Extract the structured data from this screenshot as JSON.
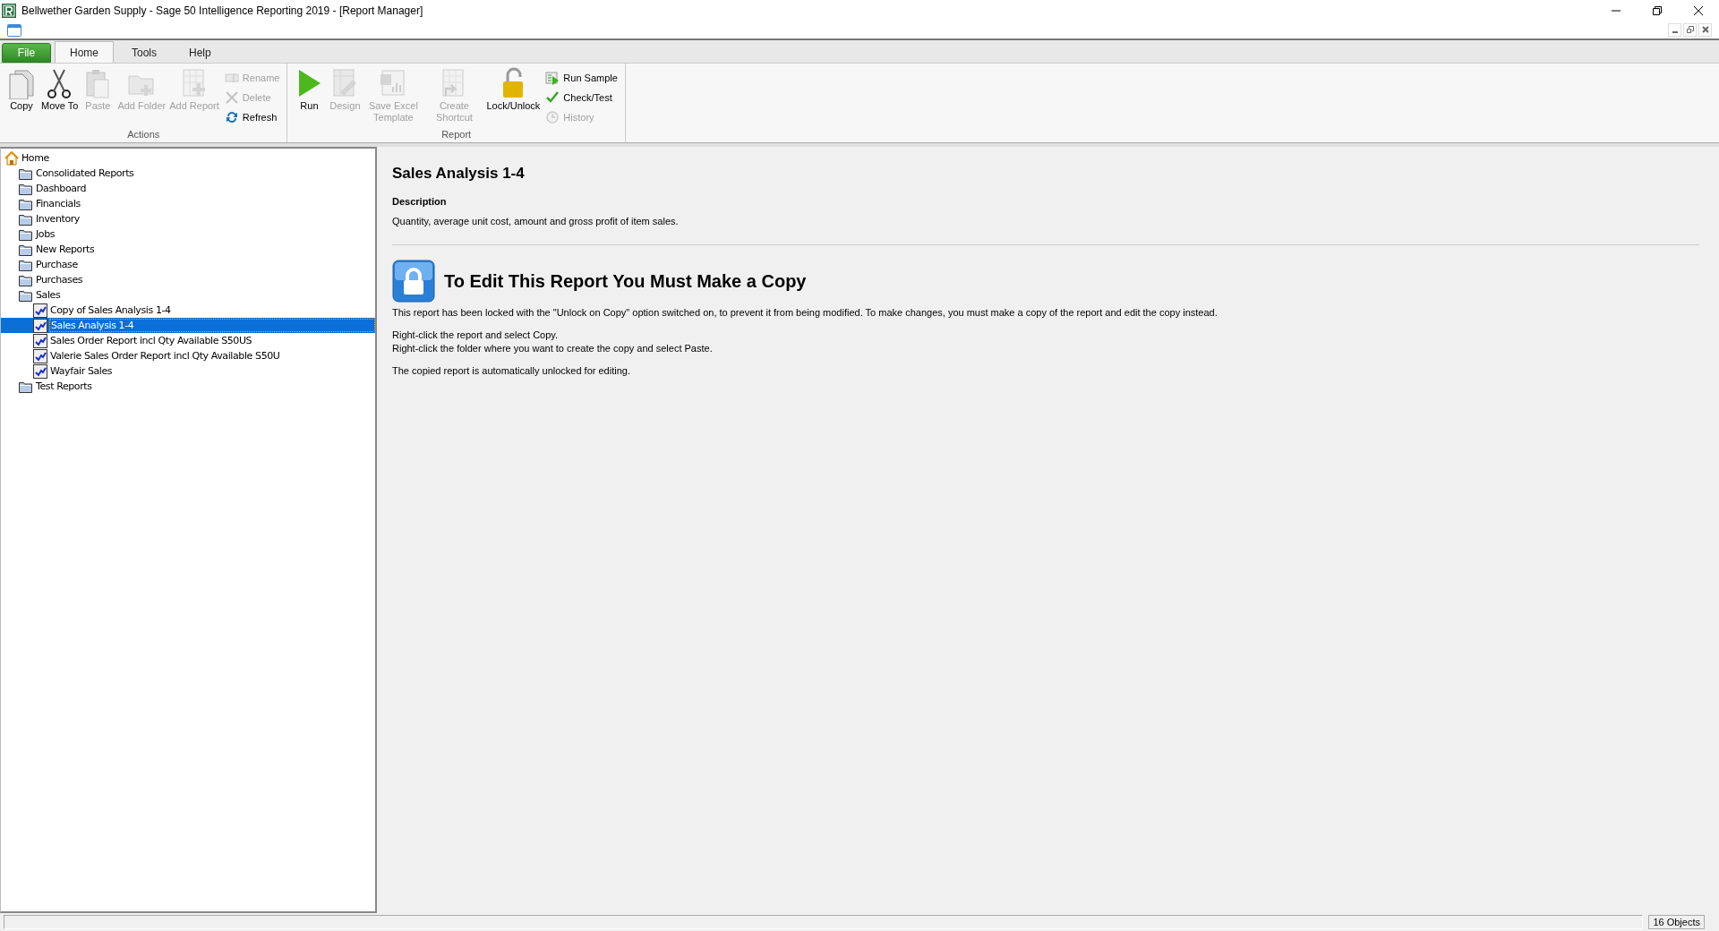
{
  "window": {
    "title": "Bellwether Garden Supply - Sage 50 Intelligence Reporting 2019 - [Report Manager]"
  },
  "ribbon": {
    "file_tab": "File",
    "tabs": [
      {
        "label": "Home",
        "selected": true
      },
      {
        "label": "Tools",
        "selected": false
      },
      {
        "label": "Help",
        "selected": false
      }
    ],
    "groups": [
      {
        "label": "Actions",
        "buttons": [
          {
            "kind": "large",
            "label": "Copy",
            "disabled": false
          },
          {
            "kind": "large",
            "label": "Move To",
            "disabled": false
          },
          {
            "kind": "large",
            "label": "Paste",
            "disabled": true
          },
          {
            "kind": "large",
            "label": "Add Folder",
            "disabled": true
          },
          {
            "kind": "large",
            "label": "Add Report",
            "disabled": true
          },
          {
            "kind": "small",
            "label": "Rename",
            "disabled": true
          },
          {
            "kind": "small",
            "label": "Delete",
            "disabled": true
          },
          {
            "kind": "small",
            "label": "Refresh",
            "disabled": false
          }
        ]
      },
      {
        "label": "Report",
        "buttons": [
          {
            "kind": "large",
            "label": "Run",
            "disabled": false
          },
          {
            "kind": "large",
            "label": "Design",
            "disabled": true
          },
          {
            "kind": "large",
            "label": "Save Excel Template",
            "disabled": true
          },
          {
            "kind": "large",
            "label": "Create Shortcut",
            "disabled": true
          },
          {
            "kind": "large",
            "label": "Lock/Unlock",
            "disabled": false
          },
          {
            "kind": "small",
            "label": "Run Sample",
            "disabled": false
          },
          {
            "kind": "small",
            "label": "Check/Test",
            "disabled": false
          },
          {
            "kind": "small",
            "label": "History",
            "disabled": true
          }
        ]
      }
    ]
  },
  "tree": [
    {
      "kind": "home",
      "label": "Home",
      "selected": false,
      "children": [
        {
          "kind": "folder",
          "label": "Consolidated Reports",
          "selected": false
        },
        {
          "kind": "folder",
          "label": "Dashboard",
          "selected": false
        },
        {
          "kind": "folder",
          "label": "Financials",
          "selected": false
        },
        {
          "kind": "folder",
          "label": "Inventory",
          "selected": false
        },
        {
          "kind": "folder",
          "label": "Jobs",
          "selected": false
        },
        {
          "kind": "folder",
          "label": "New Reports",
          "selected": false
        },
        {
          "kind": "folder",
          "label": "Purchase",
          "selected": false
        },
        {
          "kind": "folder",
          "label": "Purchases",
          "selected": false
        },
        {
          "kind": "folder",
          "label": "Sales",
          "selected": false,
          "children": [
            {
              "kind": "report",
              "label": "Copy of Sales Analysis 1-4",
              "selected": false
            },
            {
              "kind": "report",
              "label": "Sales Analysis 1-4",
              "selected": true
            },
            {
              "kind": "report",
              "label": "Sales Order Report incl Qty Available S50US",
              "selected": false
            },
            {
              "kind": "report",
              "label": "Valerie Sales Order Report incl Qty Available S50U",
              "selected": false
            },
            {
              "kind": "report",
              "label": "Wayfair Sales",
              "selected": false
            }
          ]
        },
        {
          "kind": "folder",
          "label": "Test Reports",
          "selected": false
        }
      ]
    }
  ],
  "details": {
    "title": "Sales Analysis 1-4",
    "description_label": "Description",
    "description": "Quantity, average unit cost, amount and gross profit of item sales.",
    "notice": {
      "heading": "To Edit This Report You Must Make a Copy",
      "paragraphs": [
        [
          "This report has been locked with the \"Unlock on Copy\" option switched on, to prevent it from being modified. To make changes, you must make a copy of the report and edit the copy instead."
        ],
        [
          "Right-click the report and select Copy.",
          "Right-click the folder where you want to create the copy and select Paste."
        ],
        [
          "The copied report is automatically unlocked for editing."
        ]
      ]
    }
  },
  "status_bar": {
    "count": "16 Objects"
  }
}
